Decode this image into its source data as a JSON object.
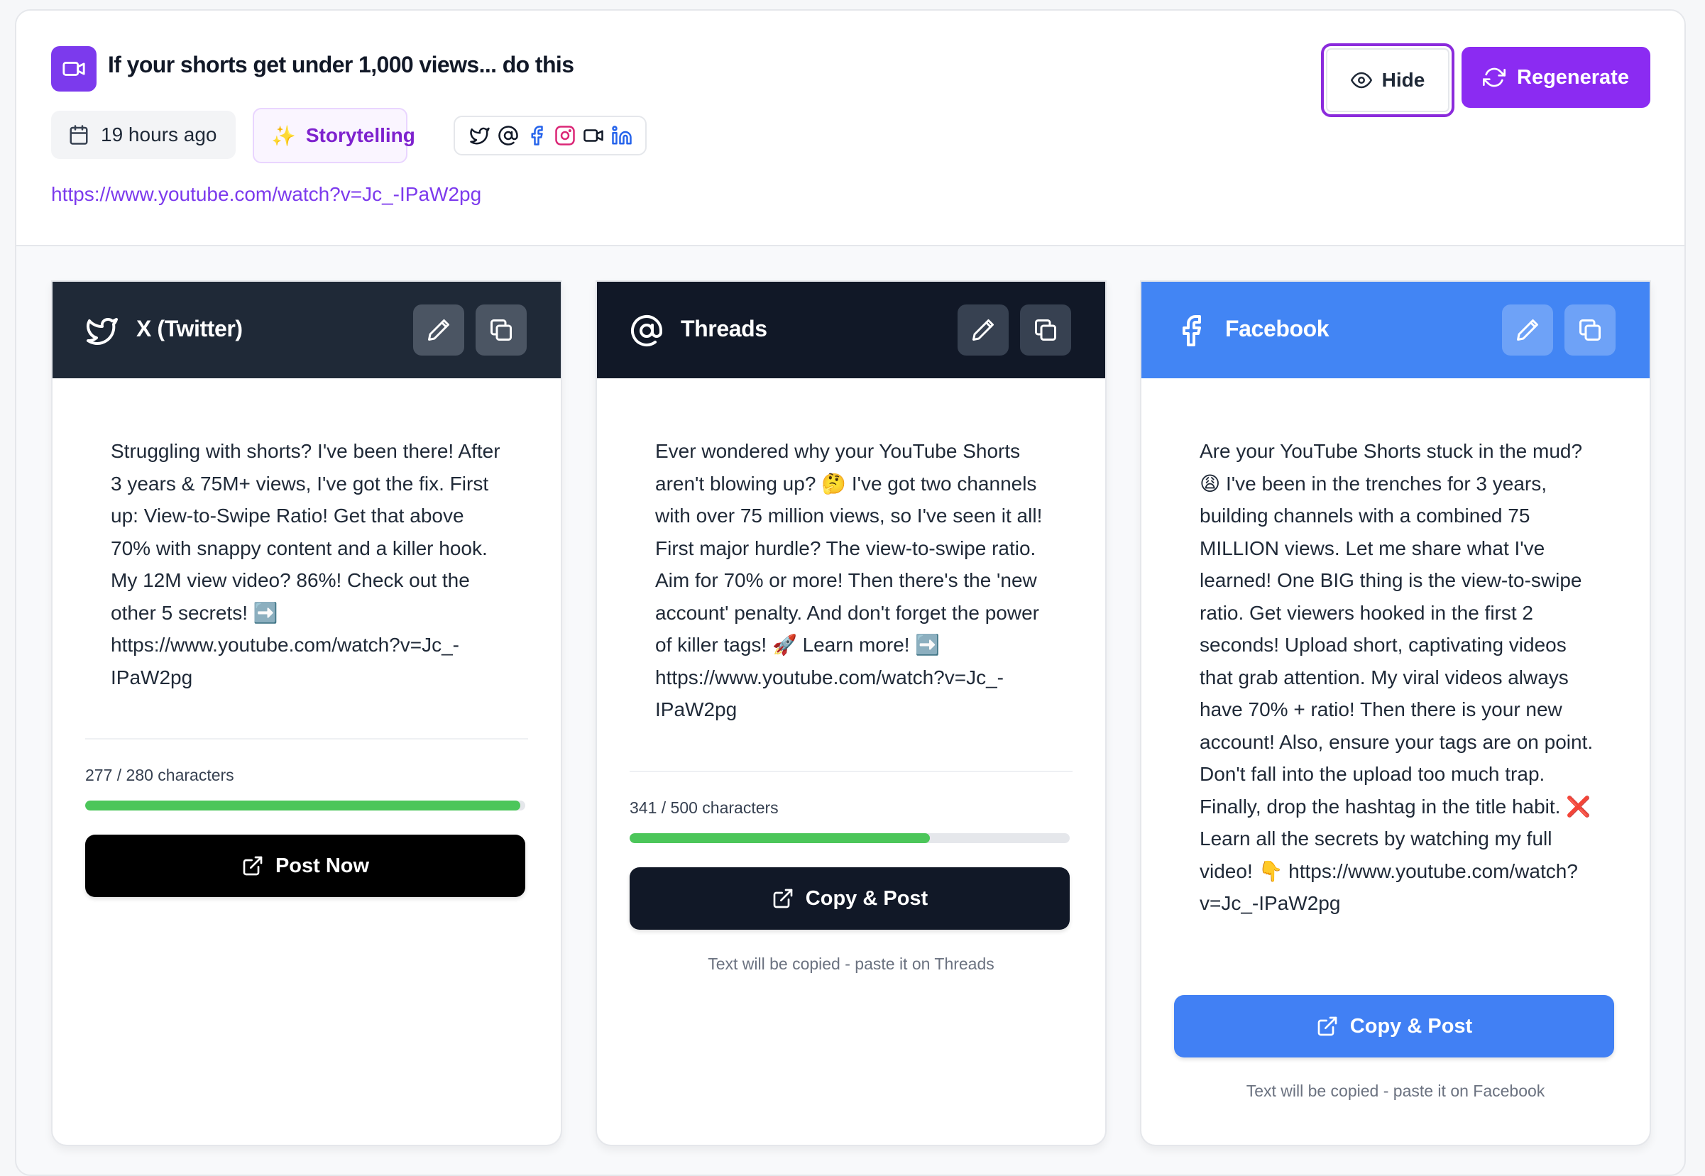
{
  "header": {
    "title": "If your shorts get under 1,000 views... do this",
    "time_ago": "19 hours ago",
    "style_tag": "Storytelling",
    "platform_icons": [
      "twitter-icon",
      "threads-icon",
      "facebook-icon",
      "instagram-icon",
      "video-icon",
      "linkedin-icon"
    ],
    "url": "https://www.youtube.com/watch?v=Jc_-IPaW2pg",
    "hide_label": "Hide",
    "regenerate_label": "Regenerate"
  },
  "cards": [
    {
      "platform": "X (Twitter)",
      "text": "Struggling with shorts? I've been there! After 3 years & 75M+ views, I've got the fix. First up: View-to-Swipe Ratio! Get that above 70% with snappy content and a killer hook. My 12M view video? 86%! Check out the other 5 secrets! ➡️ https://www.youtube.com/watch?v=Jc_-IPaW2pg",
      "count_label": "277 / 280 characters",
      "used": 277,
      "limit": 280,
      "action_label": "Post Now",
      "hint": ""
    },
    {
      "platform": "Threads",
      "text": "Ever wondered why your YouTube Shorts aren't blowing up? 🤔 I've got two channels with over 75 million views, so I've seen it all! First major hurdle? The view-to-swipe ratio. Aim for 70% or more! Then there's the 'new account' penalty. And don't forget the power of killer tags! 🚀 Learn more! ➡️ https://www.youtube.com/watch?v=Jc_-IPaW2pg",
      "count_label": "341 / 500 characters",
      "used": 341,
      "limit": 500,
      "action_label": "Copy & Post",
      "hint": "Text will be copied - paste it on Threads"
    },
    {
      "platform": "Facebook",
      "text": "Are your YouTube Shorts stuck in the mud? 😩 I've been in the trenches for 3 years, building channels with a combined 75 MILLION views. Let me share what I've learned! One BIG thing is the view-to-swipe ratio. Get viewers hooked in the first 2 seconds! Upload short, captivating videos that grab attention. My viral videos always have 70% + ratio! Then there is your new account! Also, ensure your tags are on point. Don't fall into the upload too much trap. Finally, drop the hashtag in the title habit. ❌ Learn all the secrets by watching my full video! 👇 https://www.youtube.com/watch?v=Jc_-IPaW2pg",
      "count_label": "",
      "action_label": "Copy & Post",
      "hint": "Text will be copied - paste it on Facebook"
    }
  ],
  "colors": {
    "accent": "#8b2bf2",
    "twitter_header": "#1f2937",
    "threads_header": "#111827",
    "facebook_header": "#4285f4",
    "progress": "#4cc65a"
  }
}
